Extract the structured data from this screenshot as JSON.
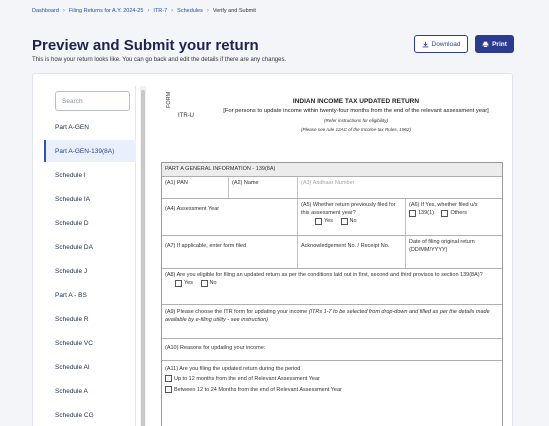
{
  "breadcrumb": [
    "Dashboard",
    "Filing Returns for A.Y. 2024-25",
    "ITR-7",
    "Schedules",
    "Verify and Submit"
  ],
  "page": {
    "title": "Preview and Submit your return",
    "subtitle": "This is how your return looks like. You can go back and edit the details if there are any changes."
  },
  "actions": {
    "download": "Download",
    "print": "Print"
  },
  "sidebar": {
    "search_placeholder": "Search",
    "items": [
      "Part A-GEN",
      "Part A-GEN-139(8A)",
      "Schedule I",
      "Schedule IA",
      "Schedule D",
      "Schedule DA",
      "Schedule J",
      "Part A - BS",
      "Schedule R",
      "Schedule VC",
      "Schedule AI",
      "Schedule A",
      "Schedule CG"
    ],
    "active_index": 1
  },
  "form": {
    "label": "FORM",
    "code": "ITR-U",
    "title": "INDIAN INCOME TAX UPDATED RETURN",
    "subtitle": "[For persons to update income within twenty-four months from the end of the relevant assessment year]",
    "note1": "(Refer instructions for eligibility)",
    "note2": "(Please see rule 12AC of the Income-tax Rules, 1962)"
  },
  "part_a": {
    "header": "PART A GENERAL INFORMATION - 139(8A)",
    "a1": "(A1) PAN",
    "a2": "(A2) Name",
    "a3": "(A3) Aadhaar Number",
    "a4": "(A4) Assessment Year",
    "a5": "(A5) Whether return previously filed for this assessment year?",
    "a5_yes": "Yes",
    "a5_no": "No",
    "a6": "(A6) If Yes, whether filed u/s",
    "a6_opt1": "139(1)",
    "a6_opt2": "Others",
    "a7": "(A7) If applicable, enter form filed",
    "ack": "Acknowledgement No. / Receipt No.",
    "date_filing": "Date of filing original return (DD/MM/YYYY)",
    "a8": "(A8) Are you eligible for filing an updated return as per the conditions laid out in first, second and third provisos to section 139(8A)?",
    "a8_yes": "Yes",
    "a8_no": "No",
    "a9_plain": "(A9) Please choose the ITR form for updating your income ",
    "a9_italic": "(ITRs 1-7 to be selected from drop-down and filled as per the details made available by e-filing utility - see instruction)",
    "a10": "(A10) Reasons for updating your income:",
    "a11": "(A11) Are you filing the updated return during the period",
    "a11_opt1": "Up to 12 months from the end of Relevant Assessment Year",
    "a11_opt2": "Between 12 to 24 Months from the end of Relevant Assessment Year"
  }
}
